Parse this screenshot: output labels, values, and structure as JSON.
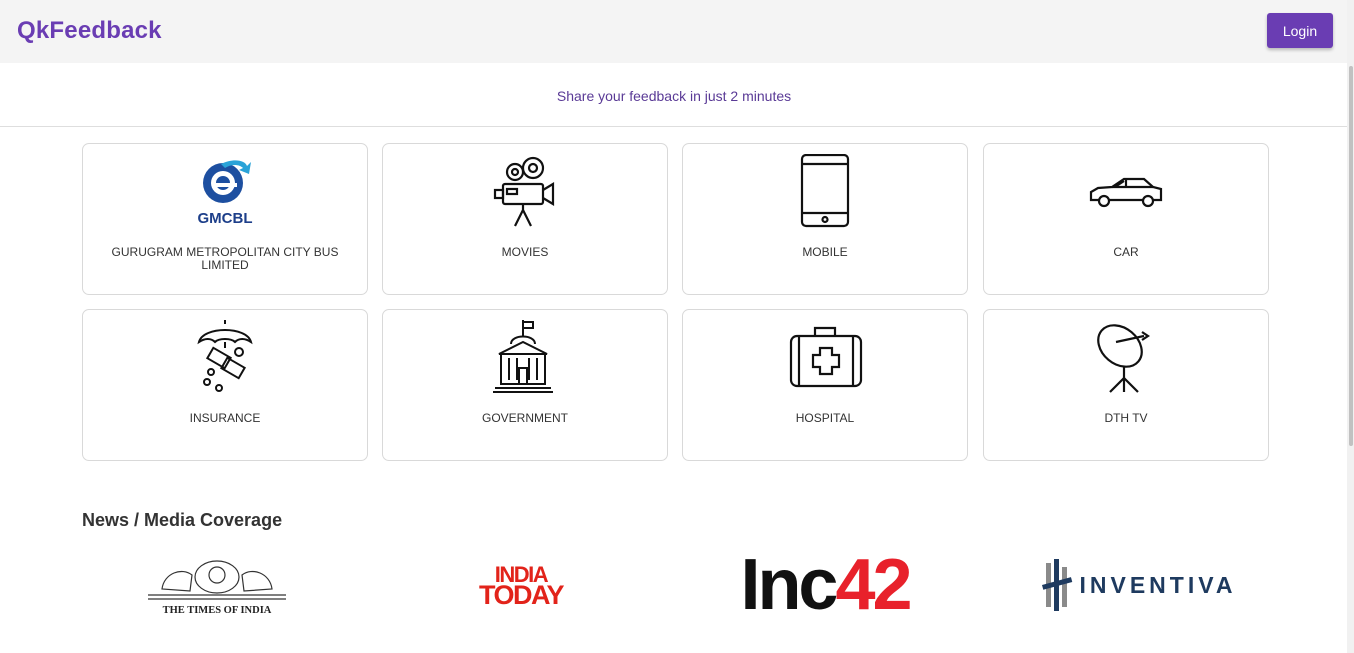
{
  "header": {
    "brand": "QkFeedback",
    "login_label": "Login"
  },
  "tagline": "Share your feedback in just 2 minutes",
  "categories": [
    {
      "label": "GURUGRAM METROPOLITAN CITY BUS LIMITED",
      "icon": "gmcbl-logo",
      "logo_text": "GMCBL"
    },
    {
      "label": "MOVIES",
      "icon": "movie-camera-icon"
    },
    {
      "label": "MOBILE",
      "icon": "mobile-phone-icon"
    },
    {
      "label": "CAR",
      "icon": "car-icon"
    },
    {
      "label": "INSURANCE",
      "icon": "insurance-umbrella-icon"
    },
    {
      "label": "GOVERNMENT",
      "icon": "government-building-icon"
    },
    {
      "label": "HOSPITAL",
      "icon": "first-aid-kit-icon"
    },
    {
      "label": "DTH TV",
      "icon": "satellite-dish-icon"
    }
  ],
  "media": {
    "title": "News / Media Coverage",
    "logos": [
      {
        "name": "THE TIMES OF INDIA"
      },
      {
        "name": "INDIA TODAY",
        "line1": "INDIA",
        "line2": "TODAY"
      },
      {
        "name": "Inc42",
        "part1": "Inc",
        "part2": "42"
      },
      {
        "name": "INVENTIVA"
      }
    ]
  },
  "colors": {
    "brand": "#6a3db3",
    "india_today_red": "#e2231a",
    "inc42_red": "#e8212b",
    "inventiva_blue": "#1e3a5f"
  }
}
